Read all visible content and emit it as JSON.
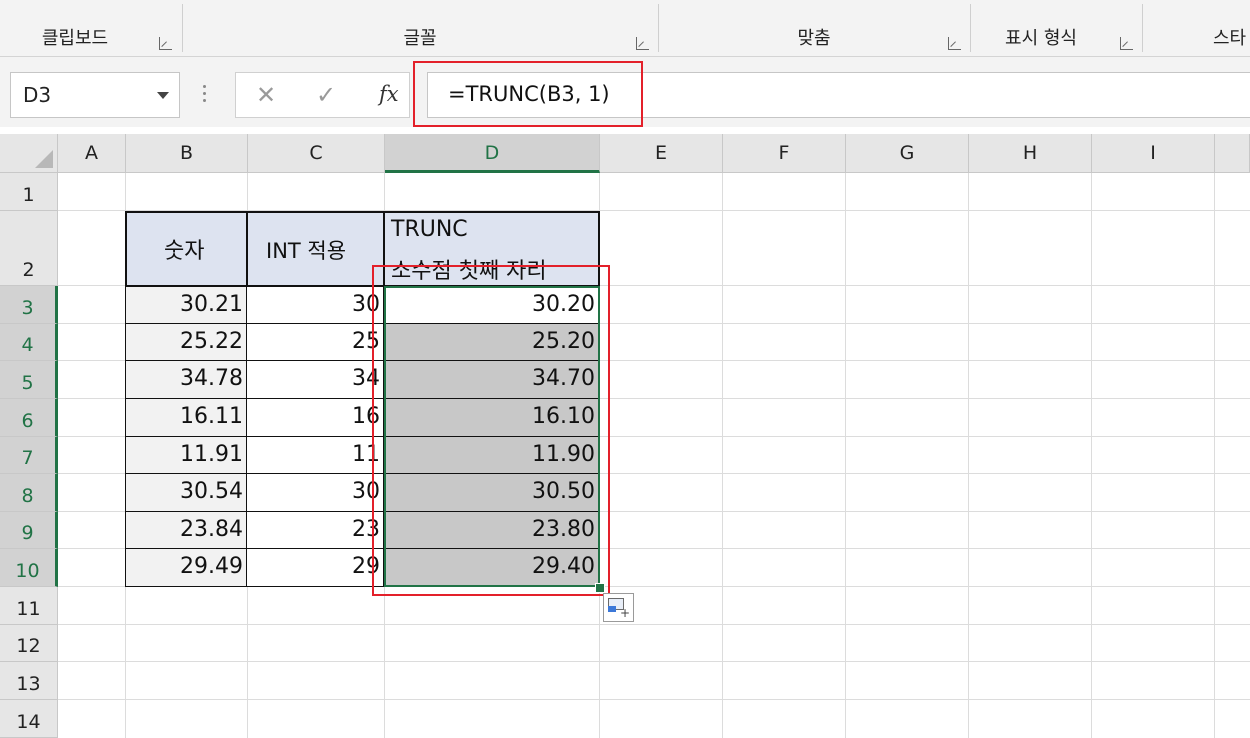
{
  "ribbon": {
    "groups": [
      {
        "label": "클립보드"
      },
      {
        "label": "글꼴"
      },
      {
        "label": "맞춤"
      },
      {
        "label": "표시 형식"
      },
      {
        "label": "스타"
      }
    ]
  },
  "formula_bar": {
    "name_box": "D3",
    "cancel_icon": "✕",
    "enter_icon": "✓",
    "fx_label": "fx",
    "formula": "=TRUNC(B3, 1)"
  },
  "columns": [
    "A",
    "B",
    "C",
    "D",
    "E",
    "F",
    "G",
    "H",
    "I"
  ],
  "rows": [
    "1",
    "2",
    "3",
    "4",
    "5",
    "6",
    "7",
    "8",
    "9",
    "10",
    "11",
    "12",
    "13",
    "14"
  ],
  "table": {
    "headers": {
      "b": "숫자",
      "c": "INT 적용",
      "d_line1": "TRUNC",
      "d_line2": "소수점 첫째 자리"
    },
    "rows": [
      {
        "b": "30.21",
        "c": "30",
        "d": "30.20"
      },
      {
        "b": "25.22",
        "c": "25",
        "d": "25.20"
      },
      {
        "b": "34.78",
        "c": "34",
        "d": "34.70"
      },
      {
        "b": "16.11",
        "c": "16",
        "d": "16.10"
      },
      {
        "b": "11.91",
        "c": "11",
        "d": "11.90"
      },
      {
        "b": "30.54",
        "c": "30",
        "d": "30.50"
      },
      {
        "b": "23.84",
        "c": "23",
        "d": "23.80"
      },
      {
        "b": "29.49",
        "c": "29",
        "d": "29.40"
      }
    ]
  },
  "colors": {
    "selection": "#217346",
    "highlight": "#e3202a",
    "header_fill": "#dde3f0"
  }
}
